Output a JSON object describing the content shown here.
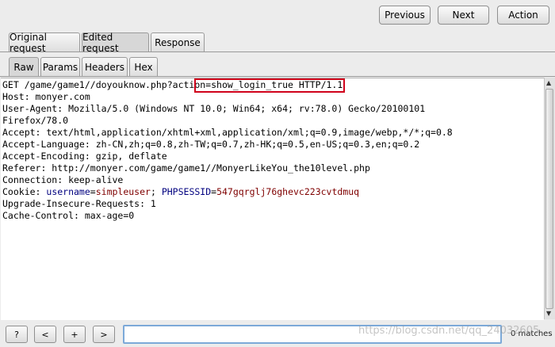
{
  "nav": {
    "previous_label": "Previous",
    "next_label": "Next",
    "action_label": "Action"
  },
  "tabs": {
    "top": [
      {
        "label": "Original request"
      },
      {
        "label": "Edited request",
        "active": true
      },
      {
        "label": "Response"
      }
    ],
    "sub": [
      {
        "label": "Raw",
        "active": true
      },
      {
        "label": "Params"
      },
      {
        "label": "Headers"
      },
      {
        "label": "Hex"
      }
    ]
  },
  "request": {
    "line1_pre": "GET /game/game1//doyouknow.php?",
    "line1_param": "action=show_login_true",
    "line1_post": " HTTP/1.1",
    "host": "Host: monyer.com",
    "user_agent": "User-Agent: Mozilla/5.0 (Windows NT 10.0; Win64; x64; rv:78.0) Gecko/20100101",
    "firefox": "Firefox/78.0",
    "accept": "Accept: text/html,application/xhtml+xml,application/xml;q=0.9,image/webp,*/*;q=0.8",
    "accept_language": "Accept-Language: zh-CN,zh;q=0.8,zh-TW;q=0.7,zh-HK;q=0.5,en-US;q=0.3,en;q=0.2",
    "accept_encoding": "Accept-Encoding: gzip, deflate",
    "referer": "Referer: http://monyer.com/game/game1//MonyerLikeYou_the10level.php",
    "connection": "Connection: keep-alive",
    "cookie_prefix": "Cookie: ",
    "cookie_name1": "username",
    "cookie_eq1": "=",
    "cookie_val1": "simpleuser",
    "cookie_sep": "; ",
    "cookie_name2": "PHPSESSID",
    "cookie_eq2": "=",
    "cookie_val2": "547gqrglj76ghevc223cvtdmuq",
    "upgrade": "Upgrade-Insecure-Requests: 1",
    "cache_control": "Cache-Control: max-age=0"
  },
  "search": {
    "help_label": "?",
    "prev_label": "<",
    "add_label": "+",
    "next_label": ">",
    "value": "",
    "matches": "0 matches"
  },
  "watermark": "https://blog.csdn.net/qq_24032605",
  "colors": {
    "highlight": "#d0021b",
    "cookie_name": "#00007f",
    "cookie_value": "#7f0000"
  }
}
